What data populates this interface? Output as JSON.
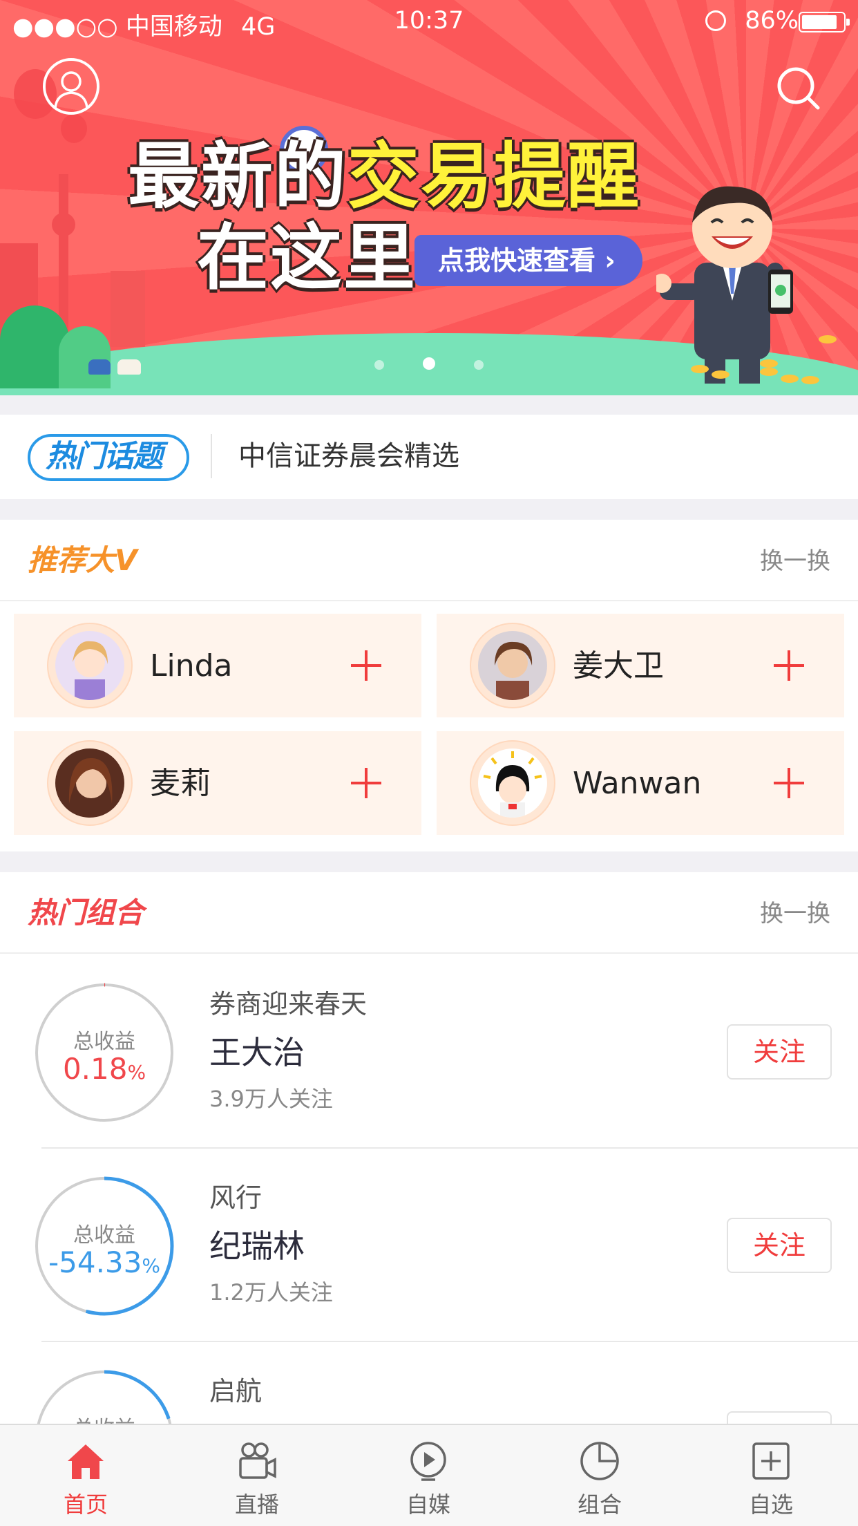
{
  "status_bar": {
    "signal": "●●●○○",
    "carrier": "中国移动",
    "network": "4G",
    "time": "10:37",
    "battery": "86%"
  },
  "banner": {
    "headline_part1": "最新的",
    "headline_accent": "交易提醒",
    "headline_line2": "在这里",
    "cta": "点我快速查看 ›",
    "page_count": 3,
    "active_page": 2
  },
  "hot_topic": {
    "badge": "热门话题",
    "text": "中信证券晨会精选"
  },
  "recommend": {
    "title": "推荐大V",
    "more": "换一换",
    "items": [
      {
        "name": "Linda"
      },
      {
        "name": "姜大卫"
      },
      {
        "name": "麦莉"
      },
      {
        "name": "Wanwan"
      }
    ]
  },
  "portfolios": {
    "title": "热门组合",
    "more": "换一换",
    "gauge_label": "总收益",
    "items": [
      {
        "subtitle": "券商迎来春天",
        "name": "王大治",
        "followers": "3.9万人关注",
        "return_value": "0.18",
        "return_unit": "%",
        "return_color": "#f0474b",
        "button": "关注",
        "progress": 0.0018
      },
      {
        "subtitle": "风行",
        "name": "纪瑞林",
        "followers": "1.2万人关注",
        "return_value": "-54.33",
        "return_unit": "%",
        "return_color": "#3c9be8",
        "button": "关注",
        "progress": 0.5433
      },
      {
        "subtitle": "启航",
        "name": "",
        "followers": "",
        "return_value": "",
        "return_unit": "",
        "return_color": "#3c9be8",
        "button": "",
        "progress": 0.2
      }
    ]
  },
  "tabbar": {
    "items": [
      {
        "label": "首页",
        "icon": "home-icon",
        "active": true
      },
      {
        "label": "直播",
        "icon": "camera-icon",
        "active": false
      },
      {
        "label": "自媒",
        "icon": "play-icon",
        "active": false
      },
      {
        "label": "组合",
        "icon": "pie-icon",
        "active": false
      },
      {
        "label": "自选",
        "icon": "add-square-icon",
        "active": false
      }
    ]
  },
  "colors": {
    "accent_red": "#f03c3c",
    "recommend_title": "#f6922a",
    "portfolio_title": "#f0474b",
    "hot_topic_blue": "#2a9ae8"
  }
}
